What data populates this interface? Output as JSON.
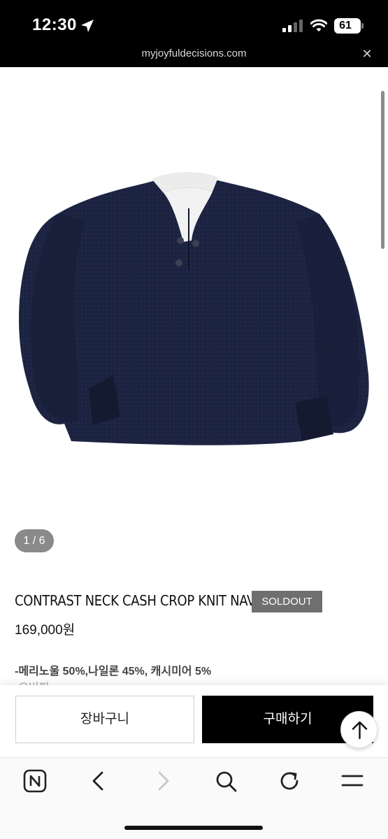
{
  "status_bar": {
    "time": "12:30",
    "battery": "61",
    "location_icon": "location-arrow-icon",
    "signal_icon": "cellular-signal-icon",
    "wifi_icon": "wifi-icon"
  },
  "browser": {
    "url": "myjoyfuldecisions.com",
    "close_glyph": "✕"
  },
  "gallery": {
    "pager": "1 / 6",
    "image": "navy-knit-sweater-image"
  },
  "product": {
    "title": "CONTRAST NECK CASH CROP KNIT NAVY",
    "badge": "SOLDOUT",
    "price": "169,000원",
    "description_line1": "-메리노울 50%,나일론 45%, 캐시미어 5%",
    "description_line2": "-오버핏"
  },
  "actions": {
    "cart_label": "장바구니",
    "buy_label": "구매하기"
  },
  "toolbar": {
    "items": [
      "n-home-icon",
      "back-icon",
      "forward-icon",
      "search-icon",
      "reload-icon",
      "menu-icon"
    ]
  },
  "colors": {
    "status_bg": "#000000",
    "buy_button": "#000000",
    "soldout_badge": "#6f6f6f",
    "sweater": "#1c2340"
  }
}
